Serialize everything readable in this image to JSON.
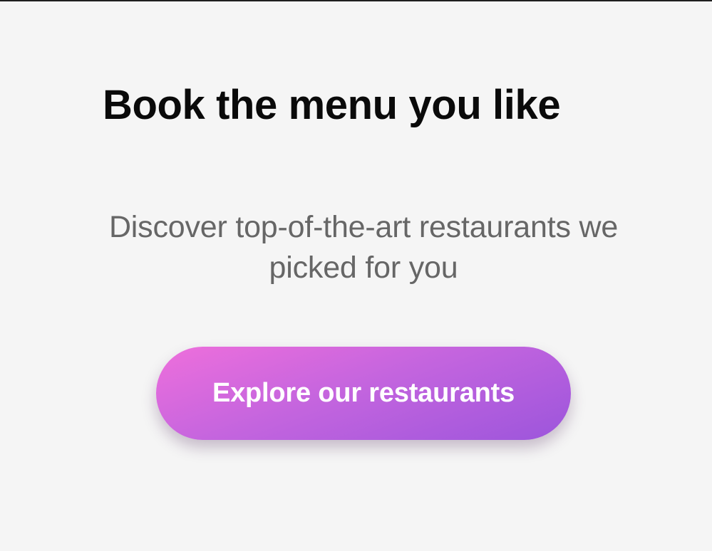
{
  "hero": {
    "title": "Book the menu you like",
    "subtitle": "Discover top-of-the-art restaurants we picked for you"
  },
  "cta": {
    "label": "Explore our restaurants"
  },
  "colors": {
    "background": "#f5f5f5",
    "title_text": "#0a0a0a",
    "subtitle_text": "#666666",
    "button_gradient_start": "#ee6fdc",
    "button_gradient_end": "#9c55dc",
    "button_text": "#ffffff"
  }
}
